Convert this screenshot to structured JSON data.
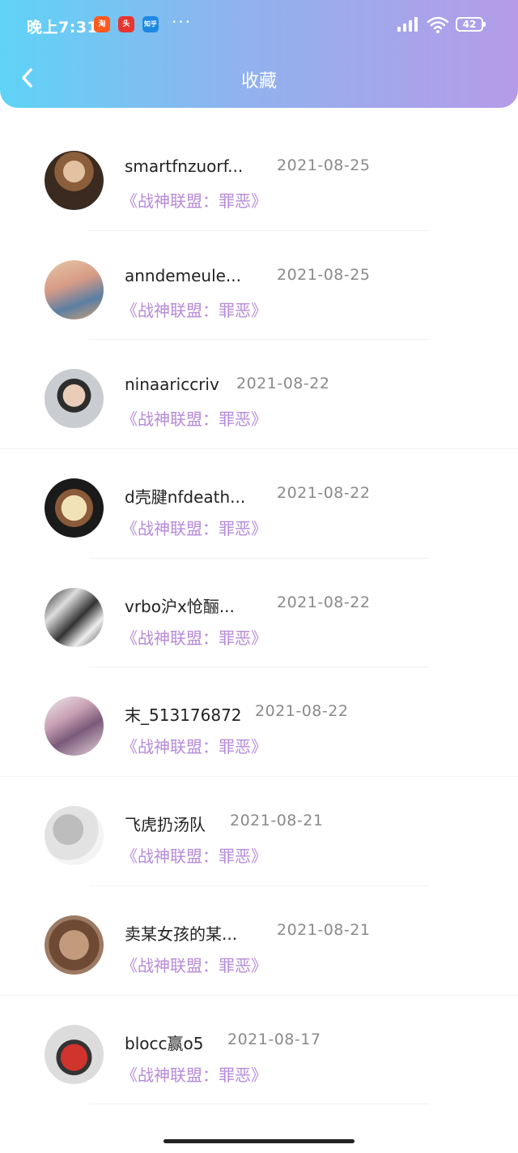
{
  "status_bar": {
    "time": "晚上7:31",
    "app_icons": [
      "淘",
      "头",
      "知乎"
    ],
    "more": "···",
    "battery": "42"
  },
  "header": {
    "title": "收藏",
    "back_icon": "chevron-left-icon",
    "gradient_start": "#5fd3f6",
    "gradient_end": "#b59be8"
  },
  "favorites": [
    {
      "name": "smartfnzuorf...",
      "date": "2021-08-25",
      "game": "《战神联盟：罪恶》",
      "avatar_color": "#b78a5e"
    },
    {
      "name": "anndemeule...",
      "date": "2021-08-25",
      "game": "《战神联盟：罪恶》",
      "avatar_color": "#c59a78"
    },
    {
      "name": "ninaariccriv",
      "date": "2021-08-22",
      "game": "《战神联盟：罪恶》",
      "avatar_color": "#6b6f74"
    },
    {
      "name": "d壳腱nfdeath...",
      "date": "2021-08-22",
      "game": "《战神联盟：罪恶》",
      "avatar_color": "#4a3a2c"
    },
    {
      "name": "vrbo沪x怆酾...",
      "date": "2021-08-22",
      "game": "《战神联盟：罪恶》",
      "avatar_color": "#777777"
    },
    {
      "name": "末_513176872",
      "date": "2021-08-22",
      "game": "《战神联盟：罪恶》",
      "avatar_color": "#c9a2b4"
    },
    {
      "name": "飞虎扔汤队",
      "date": "2021-08-21",
      "game": "《战神联盟：罪恶》",
      "avatar_color": "#d2d2d2"
    },
    {
      "name": "卖某女孩的某...",
      "date": "2021-08-21",
      "game": "《战神联盟：罪恶》",
      "avatar_color": "#8a6a52"
    },
    {
      "name": "blocc赢o5",
      "date": "2021-08-17",
      "game": "《战神联盟：罪恶》",
      "avatar_color": "#c8c8c8"
    }
  ],
  "colors": {
    "game_title": "#b68ad9",
    "date": "#8a8a8a",
    "name": "#222222"
  }
}
